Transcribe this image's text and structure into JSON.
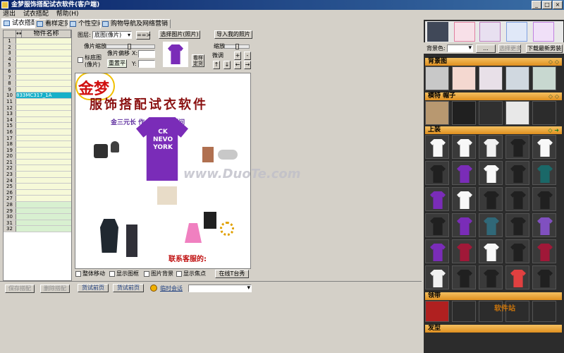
{
  "window": {
    "title": "金梦服饰搭配试衣软件(客户端)"
  },
  "menu": {
    "items": [
      "退出",
      "试衣搭配",
      "帮助(H)"
    ]
  },
  "tabs": [
    {
      "label": "试衣搭配",
      "active": true
    },
    {
      "label": "看样定货",
      "active": false
    },
    {
      "label": "个性空间",
      "active": false
    },
    {
      "label": "购物导航及网络营销",
      "active": false
    }
  ],
  "grid": {
    "header": "物件名称",
    "rows": [
      "1",
      "2",
      "3",
      "4",
      "5",
      "6",
      "7",
      "8",
      "9",
      "10",
      "11",
      "12",
      "13",
      "14",
      "15",
      "16",
      "17",
      "18",
      "19",
      "20",
      "21",
      "22",
      "23",
      "24",
      "25",
      "26",
      "27",
      "28",
      "29",
      "30",
      "31",
      "32"
    ],
    "selected_row": "10",
    "selected_value": "833MC317_1A"
  },
  "controls": {
    "layer_label": "图层:",
    "layer_value": "底图(像片)",
    "arrow_btn": "==>",
    "select_image_btn": "选择图片(照片)",
    "import_photo_btn": "导入我的照片",
    "pixel_scale_label": "像片缩放:",
    "zoom_label": "缩放",
    "fine_tune_label": "微调",
    "is_base_label": "标底图(像片)",
    "pixel_offset_label": "像片偏移",
    "x_label": "X:",
    "y_label": "Y:",
    "reset_btn": "重置平",
    "swap_btn": "看样\n定货",
    "plus": "+",
    "minus": "-"
  },
  "canvas": {
    "logo_text": "金梦",
    "headline": "服饰搭配试衣软件",
    "subline": "金三元长    作    梦想女装顾问",
    "tshirt_text": "CK\nNEVO\nYORK",
    "phone_text": "联系客服的:",
    "watermark": "www.DuoTe.com"
  },
  "options": {
    "move_all": "整体移动",
    "show_border": "显示图框",
    "image_bg": "图片背景",
    "show_focus": "显示焦点",
    "online_btn": "在线T台秀"
  },
  "bottom": {
    "save_btn": "保存搭配",
    "delete_btn": "删除搭配",
    "prev_page_btn": "货试前页",
    "next_page_btn": "货试前页",
    "chat_label": "临时会话"
  },
  "right_panel": {
    "bg_color_label": "背景色:",
    "dots_btn": "...",
    "more_btn": "选择更多",
    "download_btn": "下载最新男装",
    "sections": [
      {
        "label": "背景图"
      },
      {
        "label": "模特 帽子"
      },
      {
        "label": "上装"
      },
      {
        "label": "领带"
      },
      {
        "label": "发型"
      }
    ],
    "watermark": "软件站"
  },
  "colors": {
    "titlebar": "#0a246a",
    "accent": "#e09020",
    "selected": "#18b0c8",
    "headline": "#8a1010",
    "purple": "#7a2cb8"
  }
}
